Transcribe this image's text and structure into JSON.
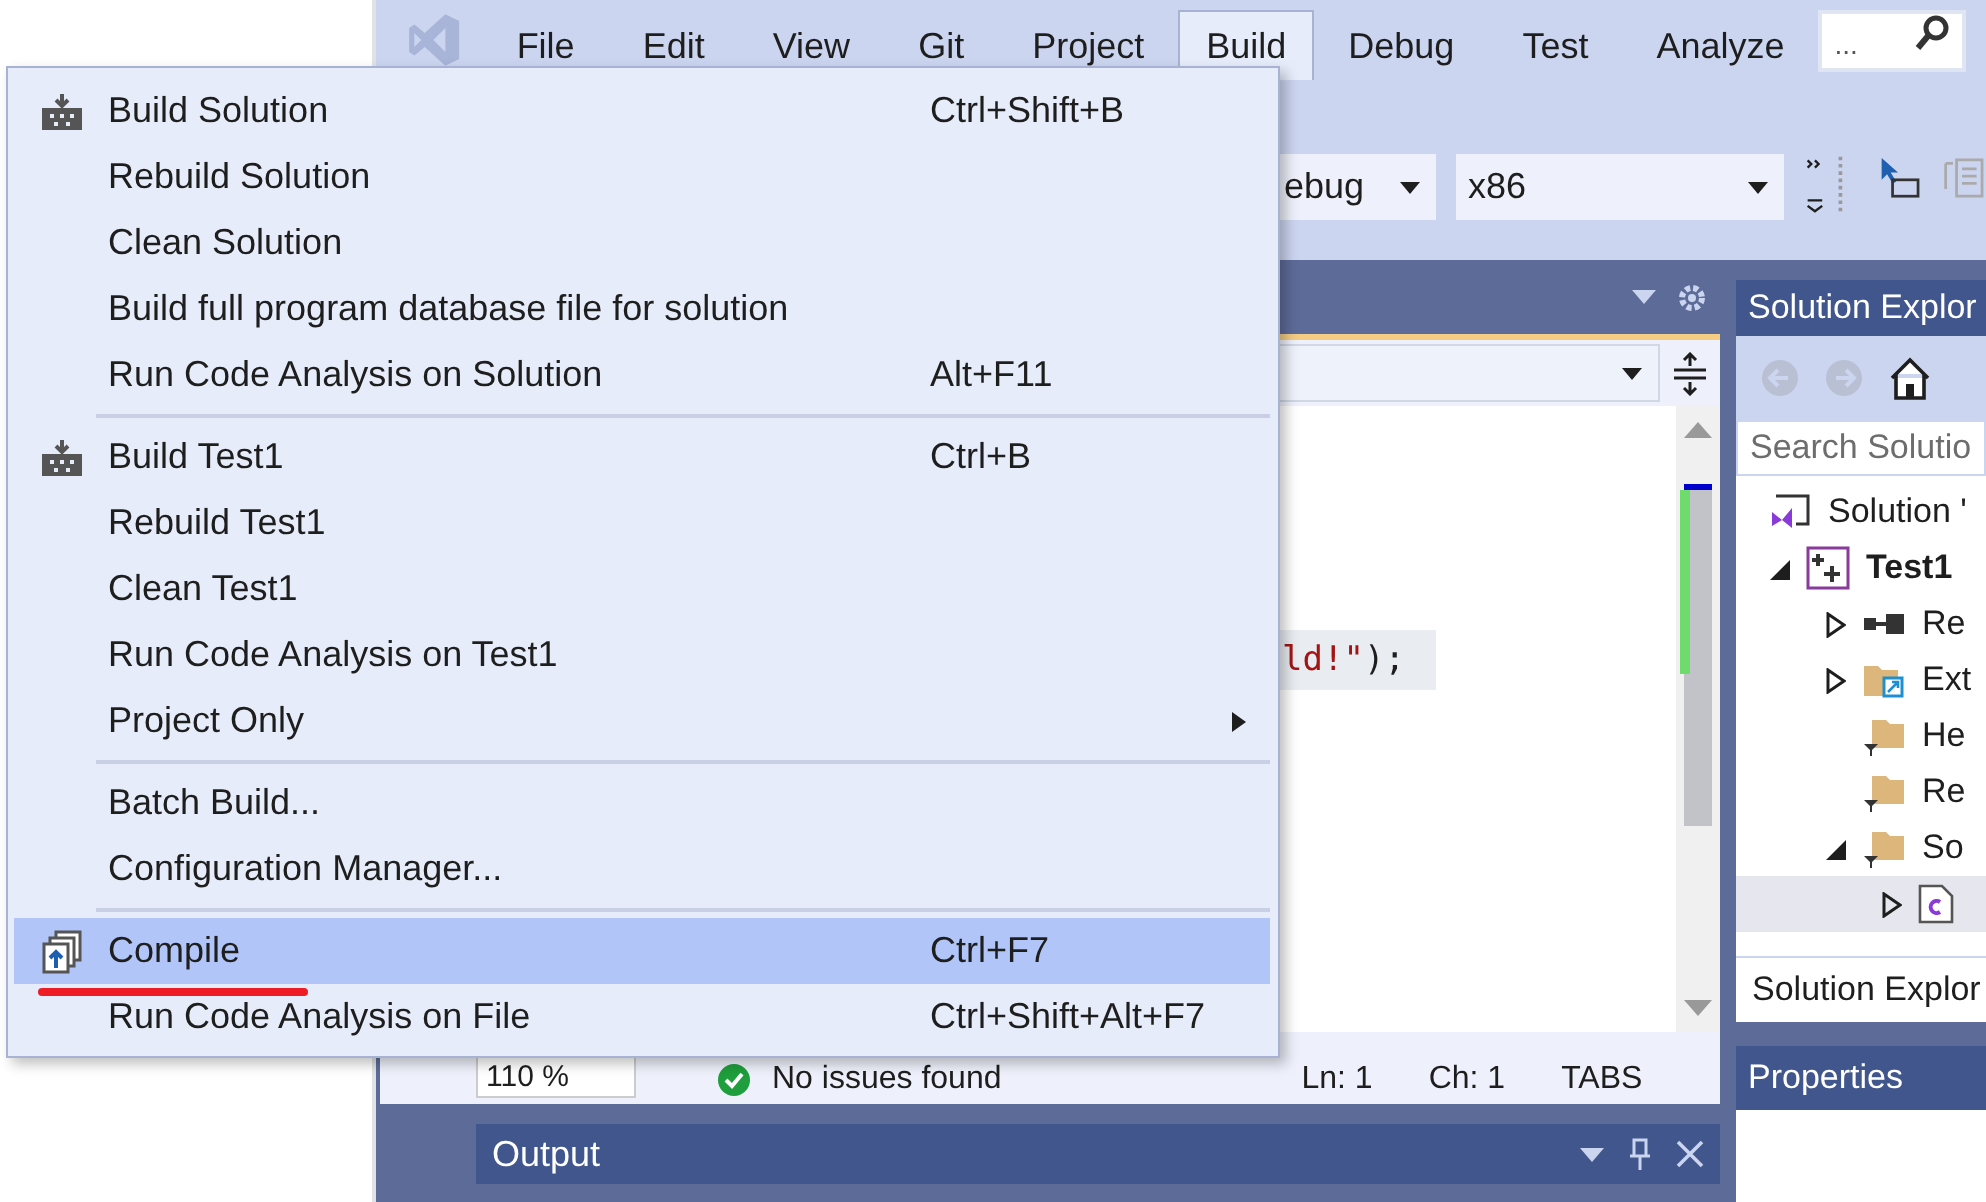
{
  "menubar": {
    "items": [
      {
        "label": "File",
        "selected": false
      },
      {
        "label": "Edit",
        "selected": false
      },
      {
        "label": "View",
        "selected": false
      },
      {
        "label": "Git",
        "selected": false
      },
      {
        "label": "Project",
        "selected": false
      },
      {
        "label": "Build",
        "selected": true
      },
      {
        "label": "Debug",
        "selected": false
      },
      {
        "label": "Test",
        "selected": false
      },
      {
        "label": "Analyze",
        "selected": false
      }
    ],
    "search": {
      "placeholder": "..."
    }
  },
  "toolbar": {
    "configuration": "ebug",
    "platform": "x86"
  },
  "editor": {
    "code_line": "ld!\");",
    "status": {
      "zoom": "110 %",
      "issues": "No issues found",
      "line": "Ln: 1",
      "column": "Ch: 1",
      "indent": "TABS"
    }
  },
  "output": {
    "title": "Output"
  },
  "solution_explorer": {
    "title": "Solution Explor",
    "search": {
      "placeholder": "Search Solutio"
    },
    "tree": [
      {
        "kind": "solution",
        "label": "Solution '",
        "selected": false,
        "children": [
          {
            "kind": "project",
            "label": "Test1",
            "expanded": true,
            "selected": false,
            "children": [
              {
                "kind": "references",
                "label": "Re",
                "expanded": false,
                "selected": false
              },
              {
                "kind": "external",
                "label": "Ext",
                "expanded": false,
                "selected": false
              },
              {
                "kind": "filter",
                "label": "He",
                "selected": false
              },
              {
                "kind": "filter",
                "label": "Re",
                "selected": false
              },
              {
                "kind": "filter",
                "label": "So",
                "expanded": true,
                "selected": false,
                "children": [
                  {
                    "kind": "file",
                    "expanded": false,
                    "selected": true
                  }
                ]
              }
            ]
          }
        ]
      }
    ],
    "bottom_tab": "Solution Explor"
  },
  "properties": {
    "title": "Properties"
  },
  "build_menu": [
    {
      "kind": "build",
      "label": "Build Solution",
      "shortcut": "Ctrl+Shift+B",
      "selected": false
    },
    {
      "kind": "plain",
      "label": "Rebuild Solution",
      "selected": false
    },
    {
      "kind": "plain",
      "label": "Clean Solution",
      "selected": false
    },
    {
      "kind": "plain",
      "label": "Build full program database file for solution",
      "selected": false
    },
    {
      "kind": "plain",
      "label": "Run Code Analysis on Solution",
      "shortcut": "Alt+F11",
      "selected": false
    },
    {
      "kind": "separator"
    },
    {
      "kind": "build",
      "label": "Build Test1",
      "shortcut": "Ctrl+B",
      "selected": false
    },
    {
      "kind": "plain",
      "label": "Rebuild Test1",
      "selected": false
    },
    {
      "kind": "plain",
      "label": "Clean Test1",
      "selected": false
    },
    {
      "kind": "plain",
      "label": "Run Code Analysis on Test1",
      "selected": false
    },
    {
      "kind": "submenu",
      "label": "Project Only",
      "selected": false
    },
    {
      "kind": "separator"
    },
    {
      "kind": "plain",
      "label": "Batch Build...",
      "selected": false
    },
    {
      "kind": "plain",
      "label": "Configuration Manager...",
      "selected": false
    },
    {
      "kind": "separator"
    },
    {
      "kind": "compile",
      "label": "Compile",
      "shortcut": "Ctrl+F7",
      "selected": true,
      "underlined": true
    },
    {
      "kind": "plain",
      "label": "Run Code Analysis on File",
      "shortcut": "Ctrl+Shift+Alt+F7",
      "selected": false
    }
  ]
}
